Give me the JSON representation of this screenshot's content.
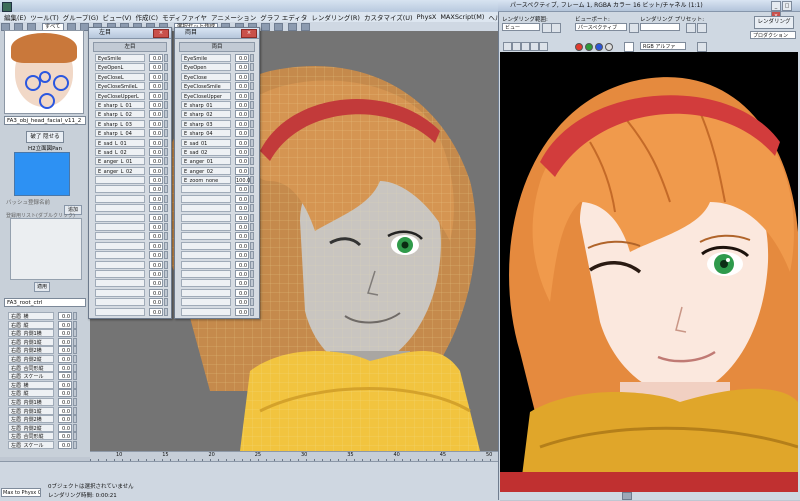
{
  "main_window": {
    "menus": [
      "編集(E)",
      "ツール(T)",
      "グループ(G)",
      "ビュー(V)",
      "作成(C)",
      "モディファイヤ",
      "アニメーション",
      "グラフ エディタ",
      "レンダリング(R)",
      "カスタマイズ(U)",
      "PhysX",
      "MAXScript(M)",
      "ヘルプ(H)"
    ],
    "toolbar": {
      "select_filter": "すべて",
      "selection_set": "選択セット作成"
    }
  },
  "left_panel": {
    "object_dropdown": "FA3_obj_head_facial_v11_2",
    "record_button": "破了 隠せる",
    "pose_label": "H2立面図Pan",
    "pose_list_caption": "バッシュ登録名前",
    "pose_add_button": "追加",
    "pose_list_caption2": "登録用リスト(ダブルクリック)",
    "pose_apply_button": "適用",
    "root_dropdown": "FA3_root_ctrl",
    "brow_rows": [
      {
        "label": "右眉_横",
        "value": "0.0"
      },
      {
        "label": "右眉_縦",
        "value": "0.0"
      },
      {
        "label": "右眉_内側1横",
        "value": "0.0"
      },
      {
        "label": "右眉_内側1縦",
        "value": "0.0"
      },
      {
        "label": "右眉_内側2横",
        "value": "0.0"
      },
      {
        "label": "右眉_内側2縦",
        "value": "0.0"
      },
      {
        "label": "右眉_合同形縦",
        "value": "0.0"
      },
      {
        "label": "右眉_スケール",
        "value": "0.0"
      },
      {
        "label": "左眉_横",
        "value": "0.0"
      },
      {
        "label": "左眉_縦",
        "value": "0.0"
      },
      {
        "label": "左眉_内側1横",
        "value": "0.0"
      },
      {
        "label": "左眉_内側1縦",
        "value": "0.0"
      },
      {
        "label": "左眉_内側2横",
        "value": "0.0"
      },
      {
        "label": "左眉_内側2縦",
        "value": "0.0"
      },
      {
        "label": "左眉_合同形縦",
        "value": "0.0"
      },
      {
        "label": "左眉_スケール",
        "value": "0.0"
      }
    ]
  },
  "eye_left_panel": {
    "title": "左目",
    "header": "左目",
    "rows": [
      {
        "label": "EyeSmile",
        "value": "0.0"
      },
      {
        "label": "EyeOpenL",
        "value": "0.0"
      },
      {
        "label": "EyeCloseL",
        "value": "0.0"
      },
      {
        "label": "EyeCloseSmileL",
        "value": "0.0"
      },
      {
        "label": "EyeCloseUpperL",
        "value": "0.0"
      },
      {
        "label": "E_sharp_L_01",
        "value": "0.0"
      },
      {
        "label": "E_sharp_L_02",
        "value": "0.0"
      },
      {
        "label": "E_sharp_L_03",
        "value": "0.0"
      },
      {
        "label": "E_sharp_L_04",
        "value": "0.0"
      },
      {
        "label": "E_sad_L_01",
        "value": "0.0"
      },
      {
        "label": "E_sad_L_02",
        "value": "0.0"
      },
      {
        "label": "E_anger_L_01",
        "value": "0.0"
      },
      {
        "label": "E_anger_L_02",
        "value": "0.0"
      },
      {
        "label": "",
        "value": "0.0"
      },
      {
        "label": "",
        "value": "0.0"
      },
      {
        "label": "",
        "value": "0.0"
      },
      {
        "label": "",
        "value": "0.0"
      },
      {
        "label": "",
        "value": "0.0"
      },
      {
        "label": "",
        "value": "0.0"
      },
      {
        "label": "",
        "value": "0.0"
      },
      {
        "label": "",
        "value": "0.0"
      },
      {
        "label": "",
        "value": "0.0"
      },
      {
        "label": "",
        "value": "0.0"
      },
      {
        "label": "",
        "value": "0.0"
      },
      {
        "label": "",
        "value": "0.0"
      },
      {
        "label": "",
        "value": "0.0"
      },
      {
        "label": "",
        "value": "0.0"
      },
      {
        "label": "",
        "value": "0.0"
      }
    ]
  },
  "eye_both_panel": {
    "title": "両目",
    "header": "両目",
    "rows": [
      {
        "label": "EyeSmile",
        "value": "0.0"
      },
      {
        "label": "EyeOpen",
        "value": "0.0"
      },
      {
        "label": "EyeClose",
        "value": "0.0"
      },
      {
        "label": "EyeCloseSmile",
        "value": "0.0"
      },
      {
        "label": "EyeCloseUpper",
        "value": "0.0"
      },
      {
        "label": "E_sharp_01",
        "value": "0.0"
      },
      {
        "label": "E_sharp_02",
        "value": "0.0"
      },
      {
        "label": "E_sharp_03",
        "value": "0.0"
      },
      {
        "label": "E_sharp_04",
        "value": "0.0"
      },
      {
        "label": "E_sad_01",
        "value": "0.0"
      },
      {
        "label": "E_sad_02",
        "value": "0.0"
      },
      {
        "label": "E_anger_01",
        "value": "0.0"
      },
      {
        "label": "E_anger_02",
        "value": "0.0"
      },
      {
        "label": "E_zoom_none",
        "value": "100.0"
      },
      {
        "label": "",
        "value": "0.0"
      },
      {
        "label": "",
        "value": "0.0"
      },
      {
        "label": "",
        "value": "0.0"
      },
      {
        "label": "",
        "value": "0.0"
      },
      {
        "label": "",
        "value": "0.0"
      },
      {
        "label": "",
        "value": "0.0"
      },
      {
        "label": "",
        "value": "0.0"
      },
      {
        "label": "",
        "value": "0.0"
      },
      {
        "label": "",
        "value": "0.0"
      },
      {
        "label": "",
        "value": "0.0"
      },
      {
        "label": "",
        "value": "0.0"
      },
      {
        "label": "",
        "value": "0.0"
      },
      {
        "label": "",
        "value": "0.0"
      },
      {
        "label": "",
        "value": "0.0"
      }
    ]
  },
  "timeline": {
    "ticks": [
      "10",
      "15",
      "20",
      "25",
      "30",
      "35",
      "40",
      "45",
      "50"
    ]
  },
  "status": {
    "maxscript": "Max to Physx C",
    "line1": "0ブジェクトは選択されていません",
    "line2": "レンダリング時間: 0:00:21"
  },
  "render_window": {
    "title": "パースペクティブ, フレーム 1, RGBA カラー 16 ビット/チャネル (1:1)",
    "area_label": "レンダリング範囲:",
    "area_value": "ビュー",
    "viewport_label": "ビューポート:",
    "viewport_value": "パースペクティブ",
    "preset_label": "レンダリング プリセット:",
    "preset_value": "",
    "render_button": "レンダリング",
    "production_value": "プロダクション",
    "channel_value": "RGB アルファ",
    "channel_dots": [
      "#e23b2e",
      "#2f9a3a",
      "#2c56d8",
      "#dddddd"
    ]
  }
}
